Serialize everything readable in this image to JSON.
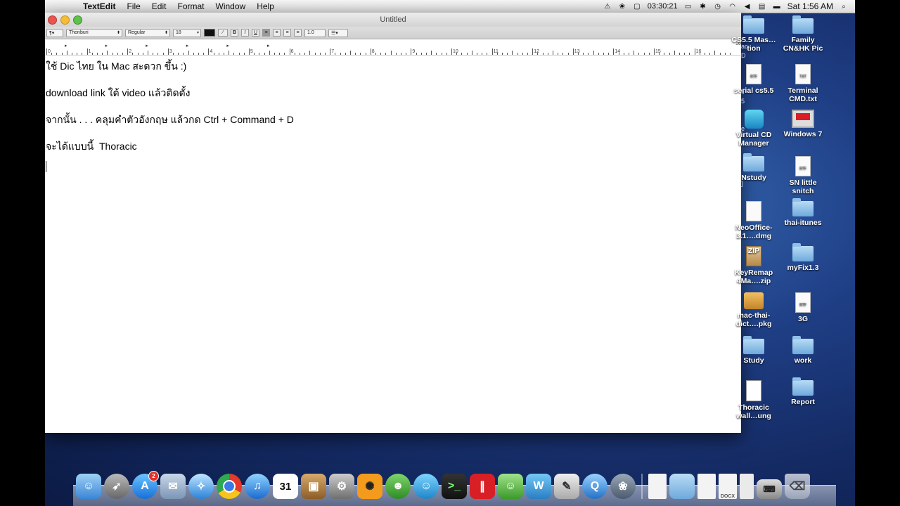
{
  "menubar": {
    "apple_glyph": "",
    "items": [
      "TextEdit",
      "File",
      "Edit",
      "Format",
      "Window",
      "Help"
    ],
    "clock": "03:30:21",
    "date": "Sat 1:56 AM"
  },
  "window": {
    "title": "Untitled",
    "toolbar": {
      "style_menu": "¶▾",
      "font": "Thonburi",
      "typeface": "Regular",
      "size": "18",
      "bold": "B",
      "italic": "I",
      "underline": "U",
      "spacing": "1.0",
      "list_menu": "☰▾"
    },
    "ruler_numbers": [
      "0",
      "1",
      "2",
      "3",
      "4",
      "5",
      "6",
      "7",
      "8",
      "9",
      "10",
      "11",
      "12",
      "13",
      "14",
      "15",
      "16",
      "17"
    ],
    "ruler_end_label": "16",
    "document_lines": [
      "ใช้ Dic ไทย ใน Mac สะดวก ขึ้น :)",
      "download link ใต้ video แล้วติดตั้ง",
      "จากนั้น . . . คลุมคำตัวอังกฤษ แล้วกด Ctrl + Command + D",
      "จะได้แบบนี้  Thoracic"
    ]
  },
  "desktop_icons": [
    {
      "label": "CS5.5 Mas…tion",
      "type": "folder"
    },
    {
      "label": "Family CN&HK Pic",
      "type": "folder"
    },
    {
      "label": "serial cs5.5",
      "type": "rtf"
    },
    {
      "label": "Terminal CMD.txt",
      "type": "txt"
    },
    {
      "label": "Virtual CD Manager",
      "type": "app"
    },
    {
      "label": "Windows 7",
      "type": "parallels"
    },
    {
      "label": "Nstudy",
      "type": "folder"
    },
    {
      "label": "SN little snitch",
      "type": "rtf"
    },
    {
      "label": "NeoOffice-3.1….dmg",
      "type": "dmg"
    },
    {
      "label": "thai-itunes",
      "type": "folder"
    },
    {
      "label": "KeyRemap 4Ma….zip",
      "type": "zip"
    },
    {
      "label": "myFix1.3",
      "type": "folder"
    },
    {
      "label": "mac-thai-dict….pkg",
      "type": "pkg"
    },
    {
      "label": "3G",
      "type": "rtf"
    },
    {
      "label": "Study",
      "type": "folder"
    },
    {
      "label": "work",
      "type": "folder"
    },
    {
      "label": "Thoracic wall…ung",
      "type": "document"
    },
    {
      "label": "Report",
      "type": "folder"
    }
  ],
  "dock": {
    "calendar_day": "31",
    "app_store_badge": "2",
    "docx_label": "DOCX"
  },
  "file_type_labels": {
    "rtf": "RTF",
    "txt": "TXT",
    "zip": "ZIP",
    "parallels": "Parallels"
  },
  "colors": {
    "desktop": "#1f3f86",
    "close": "#e9544f",
    "minimize": "#f5bd36",
    "zoom": "#5ec14a"
  }
}
